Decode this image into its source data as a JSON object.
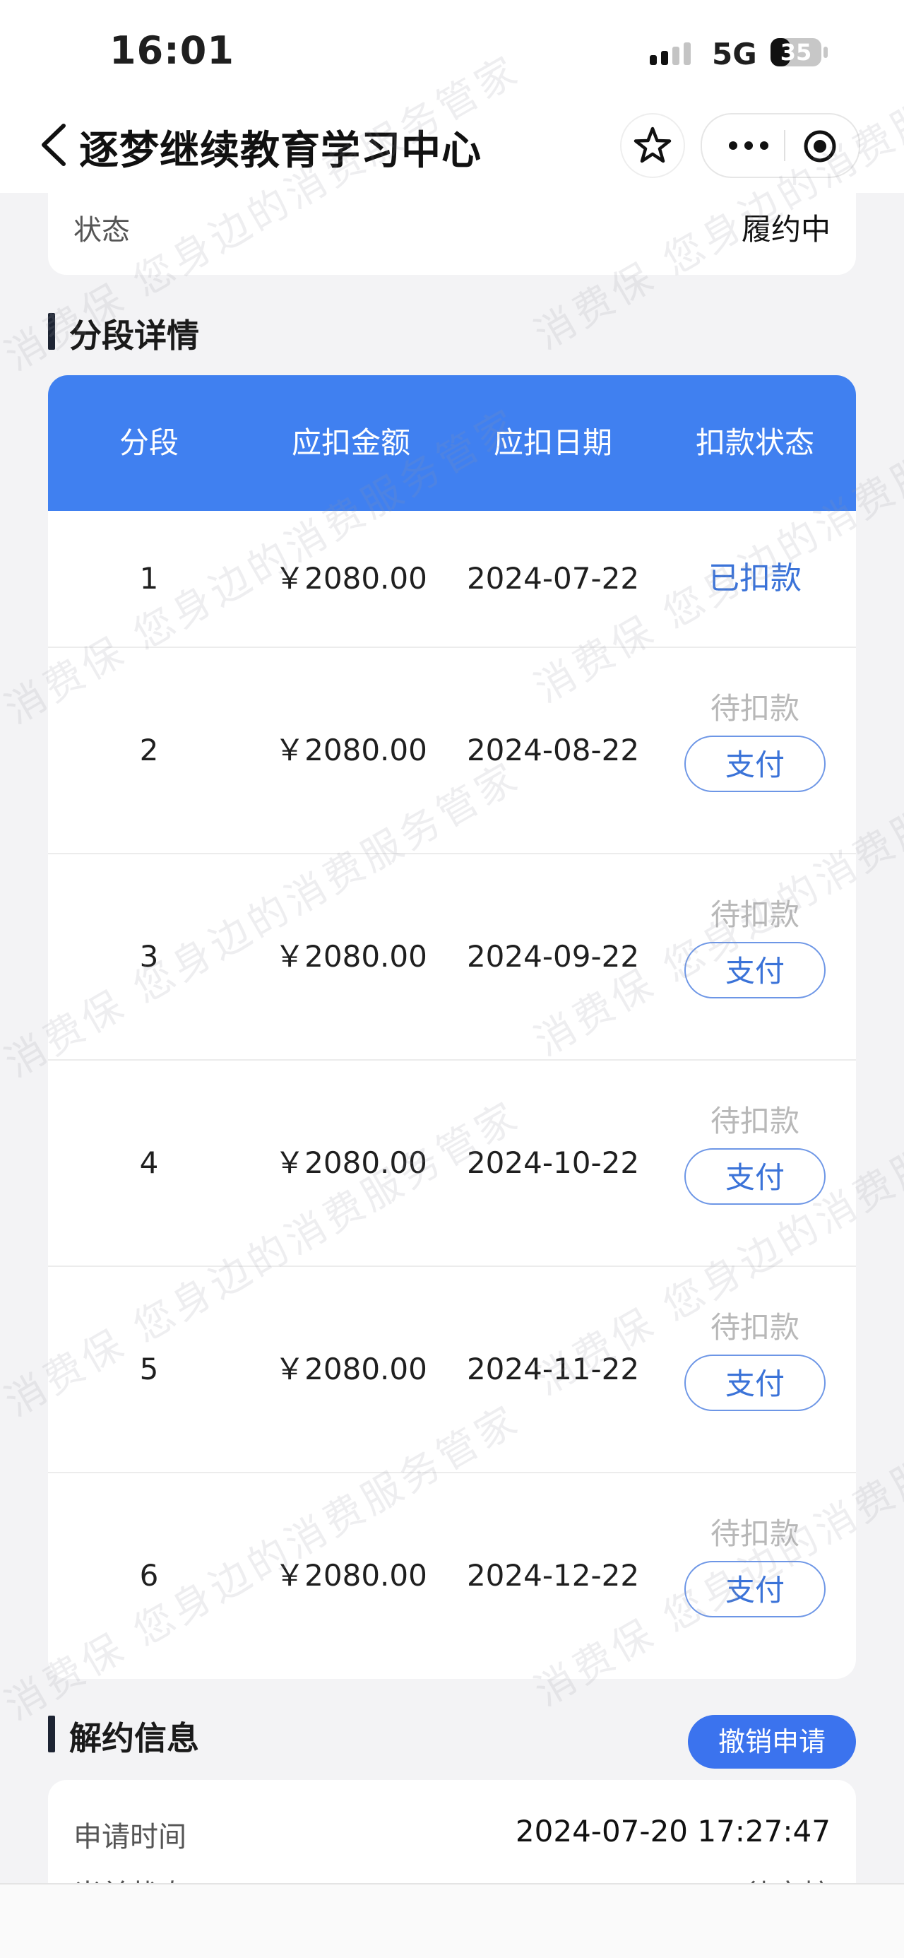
{
  "status_bar": {
    "time": "16:01",
    "network": "5G",
    "battery": "35"
  },
  "nav": {
    "title": "逐梦继续教育学习中心"
  },
  "status": {
    "label": "状态",
    "value": "履约中"
  },
  "segments": {
    "title": "分段详情",
    "headers": [
      "分段",
      "应扣金额",
      "应扣日期",
      "扣款状态"
    ],
    "rows": [
      {
        "index": "1",
        "amount": "￥2080.00",
        "date": "2024-07-22",
        "status": "已扣款",
        "action": ""
      },
      {
        "index": "2",
        "amount": "￥2080.00",
        "date": "2024-08-22",
        "status": "待扣款",
        "action": "支付"
      },
      {
        "index": "3",
        "amount": "￥2080.00",
        "date": "2024-09-22",
        "status": "待扣款",
        "action": "支付"
      },
      {
        "index": "4",
        "amount": "￥2080.00",
        "date": "2024-10-22",
        "status": "待扣款",
        "action": "支付"
      },
      {
        "index": "5",
        "amount": "￥2080.00",
        "date": "2024-11-22",
        "status": "待扣款",
        "action": "支付"
      },
      {
        "index": "6",
        "amount": "￥2080.00",
        "date": "2024-12-22",
        "status": "待扣款",
        "action": "支付"
      }
    ]
  },
  "cancellation": {
    "title": "解约信息",
    "revoke_label": "撤销申请",
    "apply_time_label": "申请时间",
    "apply_time_value": "2024-07-20 17:27:47",
    "current_status_label": "当前状态",
    "current_status_value": "待审核"
  },
  "watermark": {
    "text": "消费保 您身边的消费服务管家"
  },
  "colors": {
    "header_blue": "#4080f0",
    "link_blue": "#3b73d8",
    "button_blue": "#3b73ee",
    "pending_gray": "#b8b8b8"
  }
}
